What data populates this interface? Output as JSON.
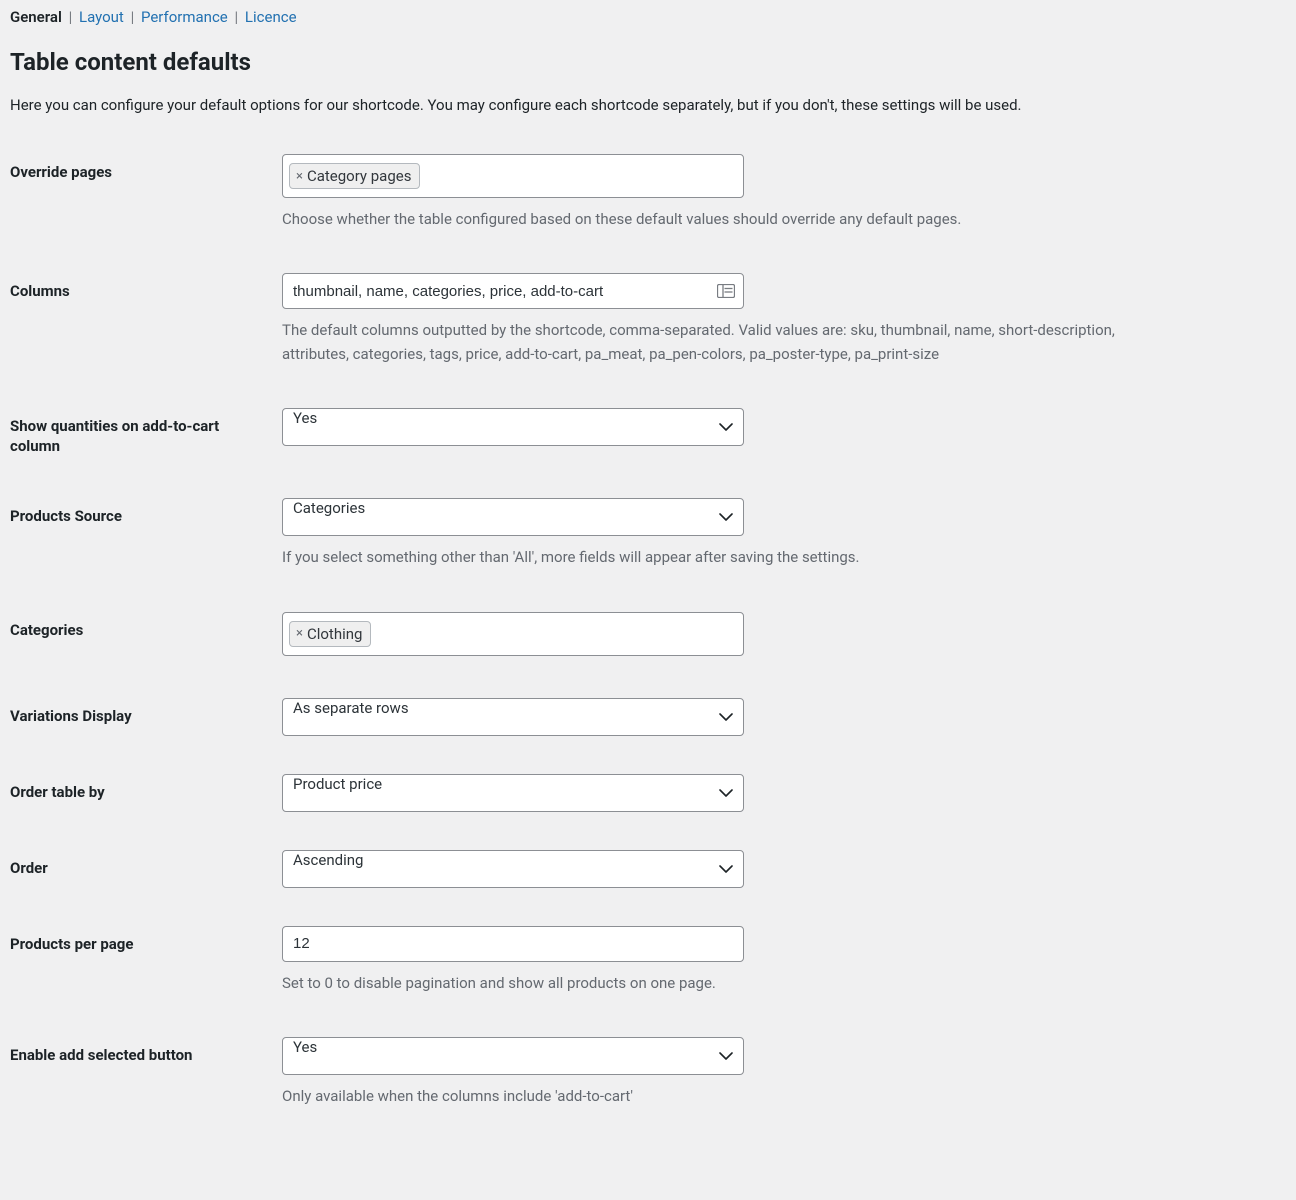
{
  "tabs": {
    "items": [
      {
        "label": "General",
        "active": true
      },
      {
        "label": "Layout",
        "active": false
      },
      {
        "label": "Performance",
        "active": false
      },
      {
        "label": "Licence",
        "active": false
      }
    ]
  },
  "page": {
    "title": "Table content defaults",
    "description": "Here you can configure your default options for our shortcode. You may configure each shortcode separately, but if you don't, these settings will be used."
  },
  "fields": {
    "override_pages": {
      "label": "Override pages",
      "tag": "Category pages",
      "help": "Choose whether the table configured based on these default values should override any default pages."
    },
    "columns": {
      "label": "Columns",
      "value": "thumbnail, name, categories, price, add-to-cart",
      "help": "The default columns outputted by the shortcode, comma-separated. Valid values are: sku, thumbnail, name, short-description, attributes, categories, tags, price, add-to-cart, pa_meat, pa_pen-colors, pa_poster-type, pa_print-size"
    },
    "show_quantities": {
      "label": "Show quantities on add-to-cart column",
      "value": "Yes"
    },
    "products_source": {
      "label": "Products Source",
      "value": "Categories",
      "help": "If you select something other than 'All', more fields will appear after saving the settings."
    },
    "categories": {
      "label": "Categories",
      "tag": "Clothing"
    },
    "variations_display": {
      "label": "Variations Display",
      "value": "As separate rows"
    },
    "order_by": {
      "label": "Order table by",
      "value": "Product price"
    },
    "order": {
      "label": "Order",
      "value": "Ascending"
    },
    "per_page": {
      "label": "Products per page",
      "value": "12",
      "help": "Set to 0 to disable pagination and show all products on one page."
    },
    "add_selected": {
      "label": "Enable add selected button",
      "value": "Yes",
      "help": "Only available when the columns include 'add-to-cart'"
    }
  }
}
